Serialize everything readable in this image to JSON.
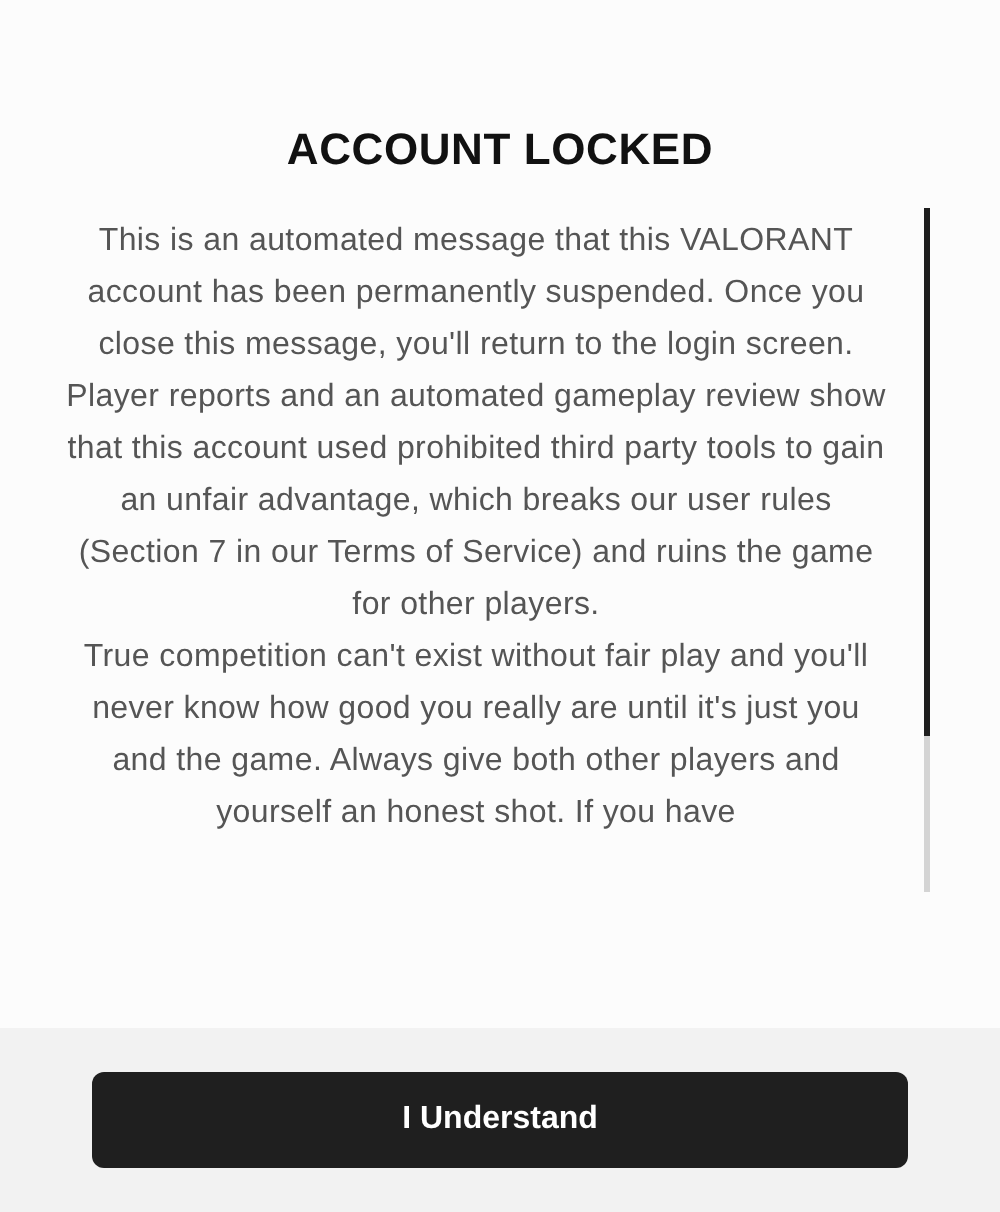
{
  "dialog": {
    "title": "ACCOUNT LOCKED",
    "paragraphs": [
      "This is an automated message that this VALORANT account has been permanently suspended. Once you close this message, you'll return to the login screen.",
      "Player reports and an automated gameplay review show that this account used prohibited third party tools to gain an unfair advantage, which breaks our user rules (Section 7 in our Terms of Service) and ruins the game for other players.",
      "True competition can't exist without fair play and you'll never know how good you really are until it's just you and the game. Always give both other players and yourself an honest shot. If you have"
    ],
    "button": "I Understand"
  }
}
